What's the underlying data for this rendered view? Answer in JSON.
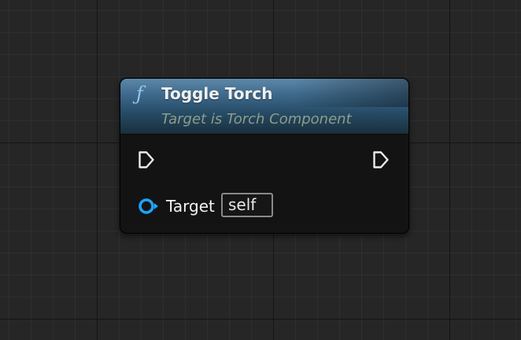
{
  "node": {
    "icon": "function-icon",
    "icon_glyph": "ƒ",
    "title": "Toggle Torch",
    "subtitle": "Target is Torch Component",
    "header_color": "#3f6a8c",
    "pins": {
      "exec_in_icon": "exec-pin-icon",
      "exec_out_icon": "exec-pin-icon",
      "target_icon": "object-reference-pin-icon",
      "target_label": "Target",
      "target_value": "self",
      "target_pin_color": "#1ea3ff"
    }
  }
}
